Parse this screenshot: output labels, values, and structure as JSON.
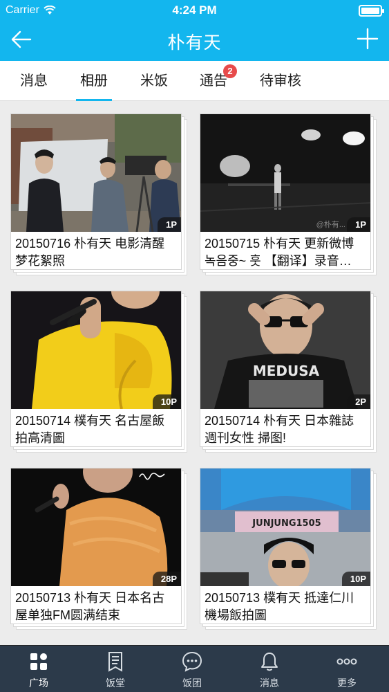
{
  "status_bar": {
    "carrier": "Carrier",
    "time": "4:24 PM"
  },
  "nav": {
    "title": "朴有天"
  },
  "tabs": [
    {
      "label": "消息",
      "active": false
    },
    {
      "label": "相册",
      "active": true
    },
    {
      "label": "米饭",
      "active": false
    },
    {
      "label": "通告",
      "active": false,
      "badge": "2"
    },
    {
      "label": "待审核",
      "active": false
    }
  ],
  "albums": [
    {
      "caption": "20150716 朴有天 电影清醒梦花絮照",
      "count": "1P"
    },
    {
      "caption": "20150715 朴有天 更新微博 녹음중~ 훗 【翻译】录音…",
      "count": "1P",
      "watermark": "@朴有..."
    },
    {
      "caption": "20150714 樸有天 名古屋飯拍高清圖",
      "count": "10P"
    },
    {
      "caption": "20150714 朴有天 日本雜誌 週刊女性 掃图!",
      "count": "2P",
      "shirt_text": "MEDUSA"
    },
    {
      "caption": "20150713 朴有天 日本名古屋单独FM圆满结束",
      "count": "28P"
    },
    {
      "caption": "20150713 樸有天 抵達仁川機場飯拍圖",
      "count": "10P",
      "banner_text": "JUNJUNG1505"
    }
  ],
  "tabbar": [
    {
      "label": "广场",
      "icon": "grid-icon"
    },
    {
      "label": "饭堂",
      "icon": "document-icon"
    },
    {
      "label": "饭团",
      "icon": "chat-bubble-icon"
    },
    {
      "label": "消息",
      "icon": "bell-icon"
    },
    {
      "label": "更多",
      "icon": "more-dots-icon"
    }
  ],
  "colors": {
    "accent": "#13b6ee",
    "badge": "#e74b4b",
    "tabbar_bg": "#2c3a4a"
  }
}
